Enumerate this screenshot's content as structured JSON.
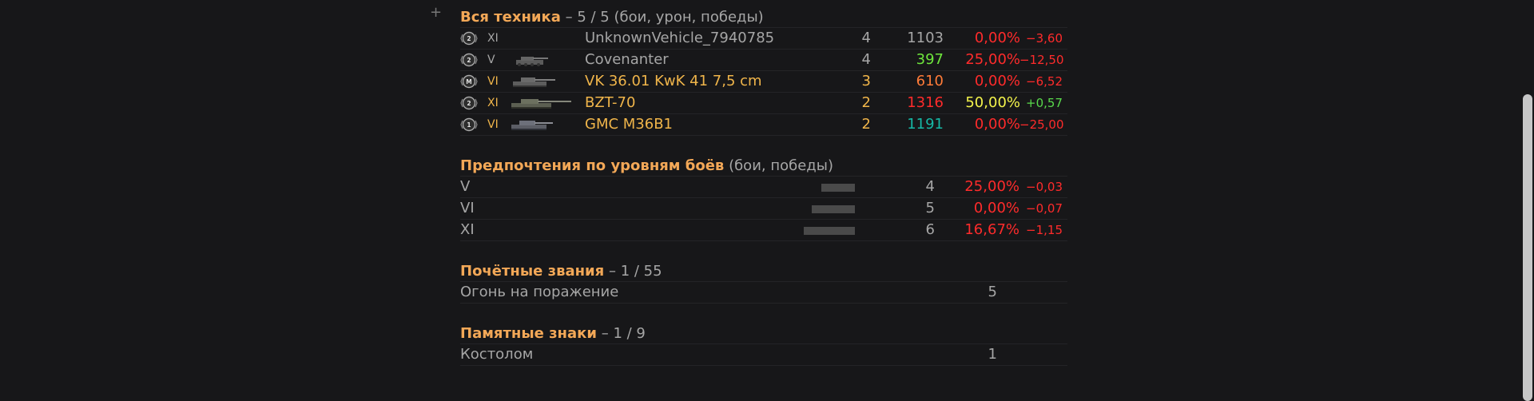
{
  "vehicles_section": {
    "title": "Вся техника",
    "summary": "– 5 / 5 (бои, урон, победы)",
    "rows": [
      {
        "rank_icon": "mastery-badge-2",
        "tier": "XI",
        "name": "UnknownVehicle_7940785",
        "battles": "4",
        "damage": "1103",
        "wins": "0,00%",
        "delta": "−3,60",
        "name_color": "#a6a6a6",
        "tier_color": "#a6a6a6",
        "battles_color": "#a6a6a6",
        "damage_color": "#a6a6a6",
        "wins_color": "#ff2b2b",
        "delta_color": "#ff2b2b"
      },
      {
        "rank_icon": "mastery-badge-2",
        "tier": "V",
        "name": "Covenanter",
        "battles": "4",
        "damage": "397",
        "wins": "25,00%",
        "delta": "−12,50",
        "name_color": "#a6a6a6",
        "tier_color": "#a6a6a6",
        "battles_color": "#a6a6a6",
        "damage_color": "#6ee63c",
        "wins_color": "#ff2b2b",
        "delta_color": "#ff2b2b"
      },
      {
        "rank_icon": "mastery-badge-m",
        "tier": "VI",
        "name": "VK 36.01 KwK 41 7,5 cm",
        "battles": "3",
        "damage": "610",
        "wins": "0,00%",
        "delta": "−6,52",
        "name_color": "#f0b54a",
        "tier_color": "#f0b54a",
        "battles_color": "#f0b54a",
        "damage_color": "#ff7b38",
        "wins_color": "#ff2b2b",
        "delta_color": "#ff2b2b"
      },
      {
        "rank_icon": "mastery-badge-2",
        "tier": "XI",
        "name": "BZT-70",
        "battles": "2",
        "damage": "1316",
        "wins": "50,00%",
        "delta": "+0,57",
        "name_color": "#f0b54a",
        "tier_color": "#f0b54a",
        "battles_color": "#f0b54a",
        "damage_color": "#ff2b2b",
        "wins_color": "#f3f34b",
        "delta_color": "#59d94c"
      },
      {
        "rank_icon": "mastery-badge-1",
        "tier": "VI",
        "name": "GMC M36B1",
        "battles": "2",
        "damage": "1191",
        "wins": "0,00%",
        "delta": "−25,00",
        "name_color": "#f0b54a",
        "tier_color": "#f0b54a",
        "battles_color": "#f0b54a",
        "damage_color": "#16b8a6",
        "wins_color": "#ff2b2b",
        "delta_color": "#ff2b2b"
      }
    ]
  },
  "preferences_section": {
    "title": "Предпочтения по уровням боёв",
    "summary": "(бои, победы)",
    "rows": [
      {
        "level": "V",
        "battles": "4",
        "wins": "25,00%",
        "delta": "−0,03",
        "bar_fraction": 0.33
      },
      {
        "level": "VI",
        "battles": "5",
        "wins": "0,00%",
        "delta": "−0,07",
        "bar_fraction": 0.42
      },
      {
        "level": "XI",
        "battles": "6",
        "wins": "16,67%",
        "delta": "−1,15",
        "bar_fraction": 0.5
      }
    ]
  },
  "honors_section": {
    "title": "Почётные звания",
    "summary": "– 1 / 55",
    "rows": [
      {
        "label": "Огонь на поражение",
        "count": "5"
      }
    ]
  },
  "badges_section": {
    "title": "Памятные знаки",
    "summary": "– 1 / 9",
    "rows": [
      {
        "label": "Костолом",
        "count": "1"
      }
    ]
  },
  "colors": {
    "accent": "#f3a857",
    "muted": "#a6a6a6",
    "negative": "#ff2b2b",
    "positive": "#59d94c",
    "warning": "#f3f34b",
    "teal": "#16b8a6"
  }
}
